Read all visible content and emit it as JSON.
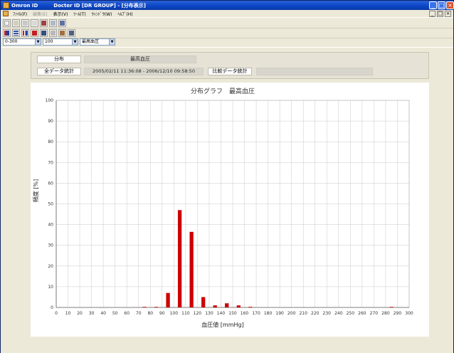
{
  "window": {
    "title": "Omron ID         Docter ID [DR GROUP] - [分布表示]",
    "controls": [
      "_",
      "□",
      "×"
    ]
  },
  "menu": {
    "items": [
      "ﾌｧｲﾙ(F)",
      "編集(E)",
      "表示(V)",
      "ﾂｰﾙ(T)",
      "ｳｨﾝﾄﾞｳ(W)",
      "ﾍﾙﾌﾟ(H)"
    ]
  },
  "filters": {
    "range": "0-300",
    "step": "100",
    "item": "最高血圧"
  },
  "info": {
    "dist_label": "分布",
    "dist_value": "最高血圧",
    "all_label": "全データ統計",
    "all_value": "2005/02/11 11:36:08 - 2006/12/10 09:58:50",
    "cmp_label": "比較データ統計",
    "cmp_value": ""
  },
  "chart_data": {
    "type": "bar",
    "title": "分布グラフ　最高血圧",
    "xlabel": "血圧値 [mmHg]",
    "ylabel": "頻度 [%]",
    "xlim": [
      0,
      300
    ],
    "ylim": [
      0,
      100
    ],
    "xticks": [
      0,
      10,
      20,
      30,
      40,
      50,
      60,
      70,
      80,
      90,
      100,
      110,
      120,
      130,
      140,
      150,
      160,
      170,
      180,
      190,
      200,
      210,
      220,
      230,
      240,
      250,
      260,
      270,
      280,
      290,
      300
    ],
    "yticks": [
      0,
      10,
      20,
      30,
      40,
      50,
      60,
      70,
      80,
      90,
      100
    ],
    "grid": true,
    "color": "#cc0000",
    "bars": [
      {
        "x": 75,
        "y": 0.2
      },
      {
        "x": 85,
        "y": 0.2
      },
      {
        "x": 95,
        "y": 7
      },
      {
        "x": 105,
        "y": 47
      },
      {
        "x": 115,
        "y": 36.5
      },
      {
        "x": 125,
        "y": 5
      },
      {
        "x": 135,
        "y": 1
      },
      {
        "x": 145,
        "y": 2
      },
      {
        "x": 155,
        "y": 1
      },
      {
        "x": 165,
        "y": 0.3
      },
      {
        "x": 285,
        "y": 0.2
      }
    ]
  }
}
